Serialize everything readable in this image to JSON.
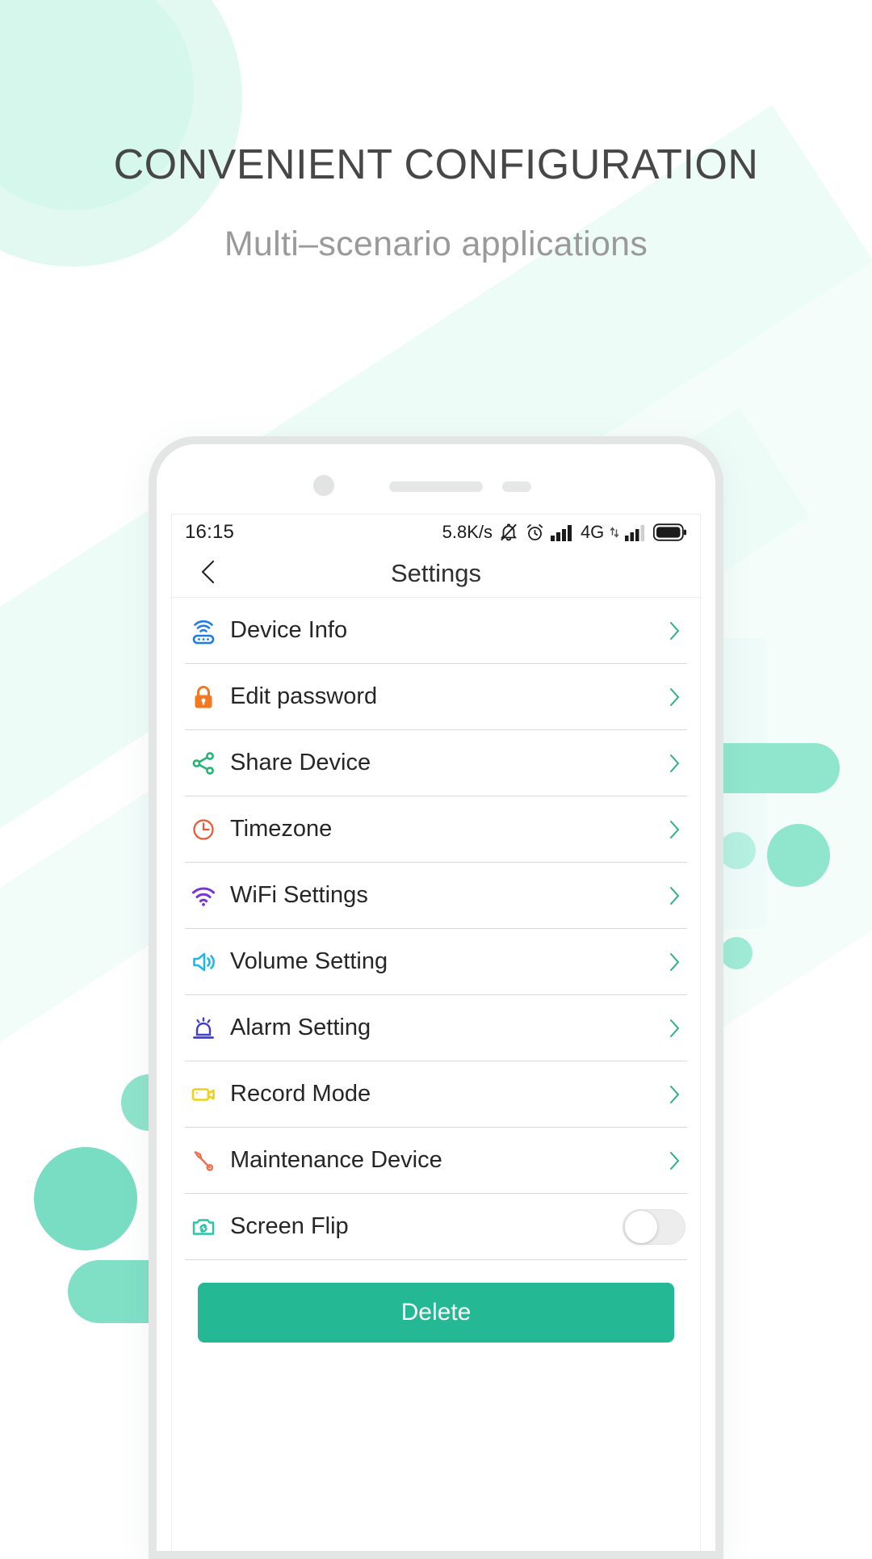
{
  "hero": {
    "headline": "CONVENIENT CONFIGURATION",
    "subheadline": "Multi–scenario applications"
  },
  "colors": {
    "accent": "#25b894",
    "headline": "#474747",
    "subheadline": "#9a9a9a",
    "chevron": "#2bb187",
    "background": "#ffffff",
    "mint": "#8fe6cd"
  },
  "phone": {
    "status_bar": {
      "time": "16:15",
      "network_speed": "5.8K/s",
      "icons": [
        "bell-muted-icon",
        "alarm-clock-icon",
        "signal-bars-icon",
        "signal-bars-secondary-icon",
        "battery-icon"
      ],
      "network_type": "4G",
      "data_arrows": "⇅"
    },
    "title_bar": {
      "back_icon": "chevron-left-icon",
      "title": "Settings"
    },
    "settings_list": [
      {
        "id": "device-info",
        "label": "Device Info",
        "icon": "router-icon",
        "icon_color": "#1f7de0",
        "control": "chevron"
      },
      {
        "id": "edit-password",
        "label": "Edit password",
        "icon": "lock-icon",
        "icon_color": "#f4781f",
        "control": "chevron"
      },
      {
        "id": "share-device",
        "label": "Share Device",
        "icon": "share-icon",
        "icon_color": "#22b573",
        "control": "chevron"
      },
      {
        "id": "timezone",
        "label": "Timezone",
        "icon": "clock-icon",
        "icon_color": "#ed5a3a",
        "control": "chevron"
      },
      {
        "id": "wifi-settings",
        "label": "WiFi Settings",
        "icon": "wifi-icon",
        "icon_color": "#7b34d8",
        "control": "chevron"
      },
      {
        "id": "volume-setting",
        "label": "Volume Setting",
        "icon": "speaker-icon",
        "icon_color": "#1fb6e8",
        "control": "chevron"
      },
      {
        "id": "alarm-setting",
        "label": "Alarm Setting",
        "icon": "siren-icon",
        "icon_color": "#3f3fd4",
        "control": "chevron"
      },
      {
        "id": "record-mode",
        "label": "Record Mode",
        "icon": "camcorder-icon",
        "icon_color": "#efd115",
        "control": "chevron"
      },
      {
        "id": "maintenance-device",
        "label": "Maintenance Device",
        "icon": "wrench-icon",
        "icon_color": "#ef7350",
        "control": "chevron"
      },
      {
        "id": "screen-flip",
        "label": "Screen Flip",
        "icon": "camera-flip-icon",
        "icon_color": "#2bc5a4",
        "control": "toggle",
        "toggle_state": "off"
      }
    ],
    "delete_button": {
      "label": "Delete"
    }
  }
}
